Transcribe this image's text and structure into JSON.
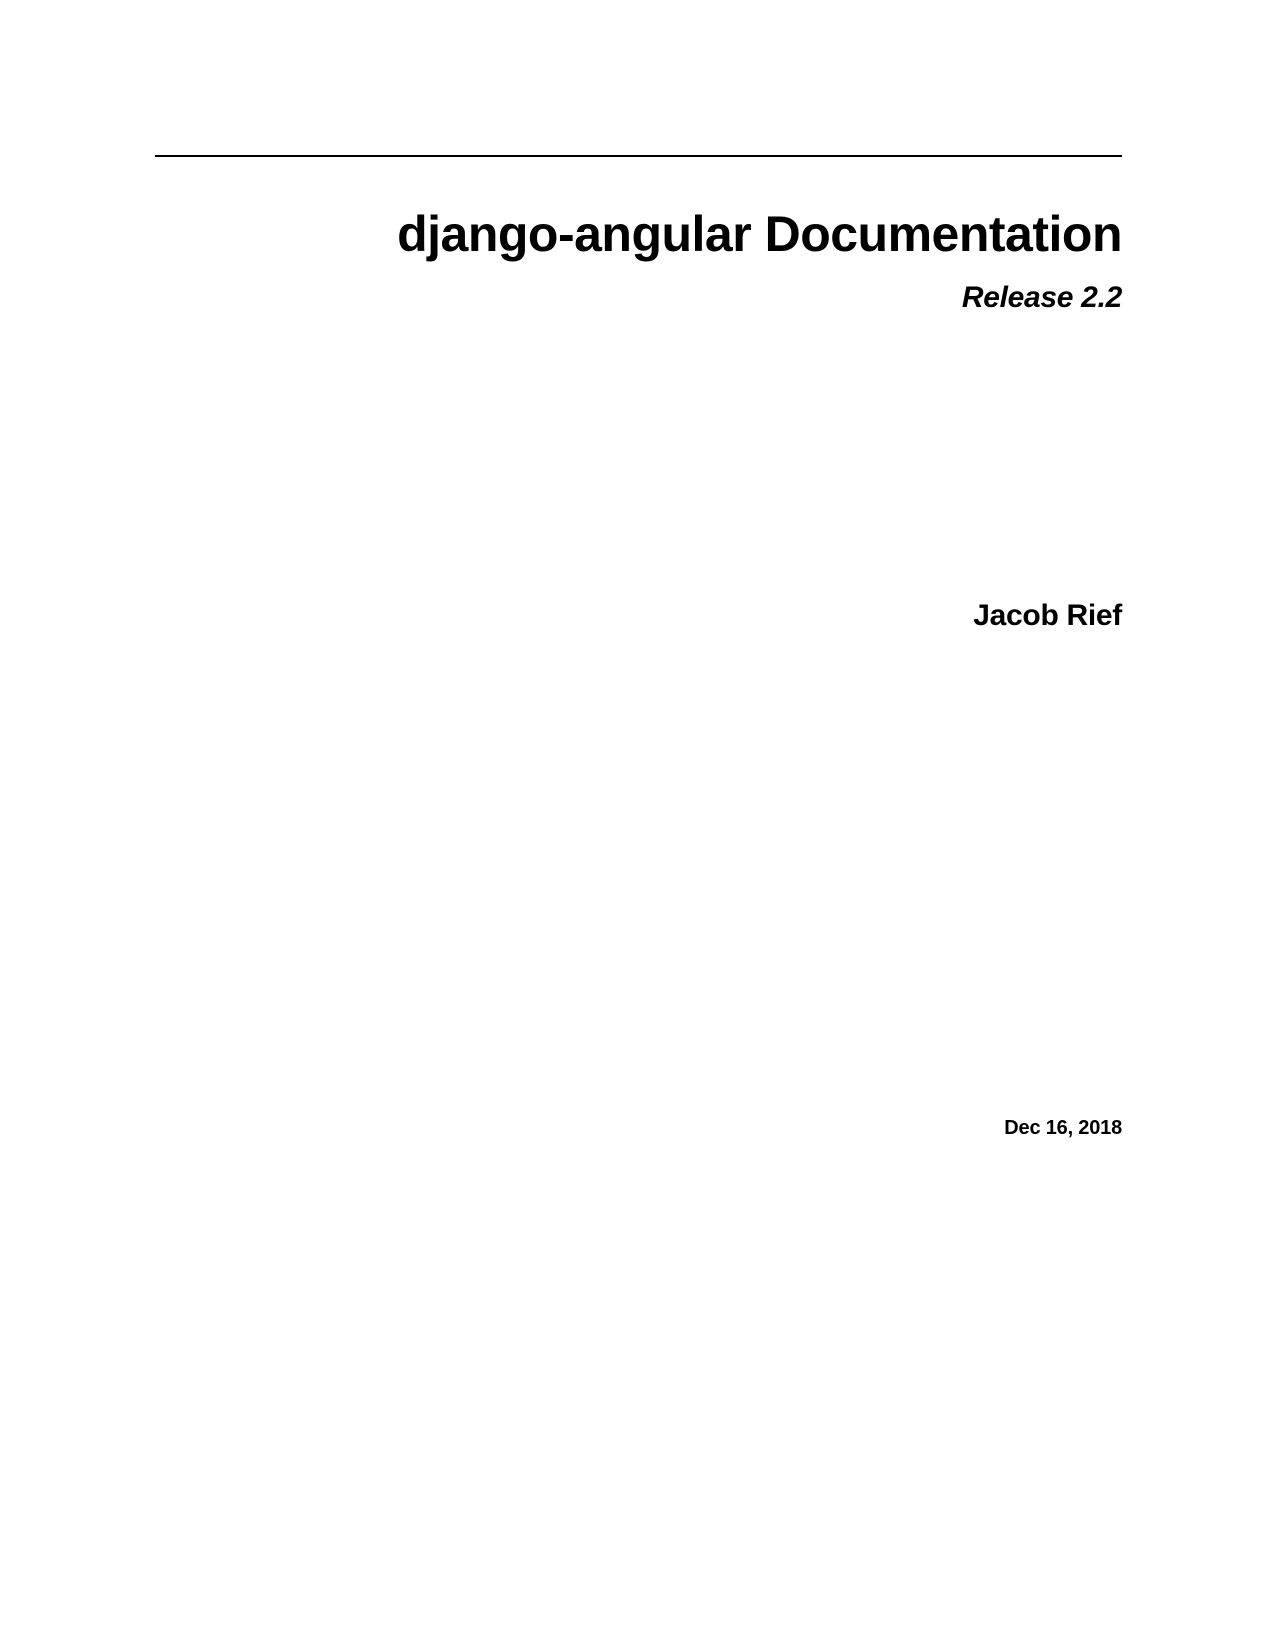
{
  "title": "django-angular Documentation",
  "release": "Release 2.2",
  "author": "Jacob Rief",
  "date": "Dec 16, 2018"
}
